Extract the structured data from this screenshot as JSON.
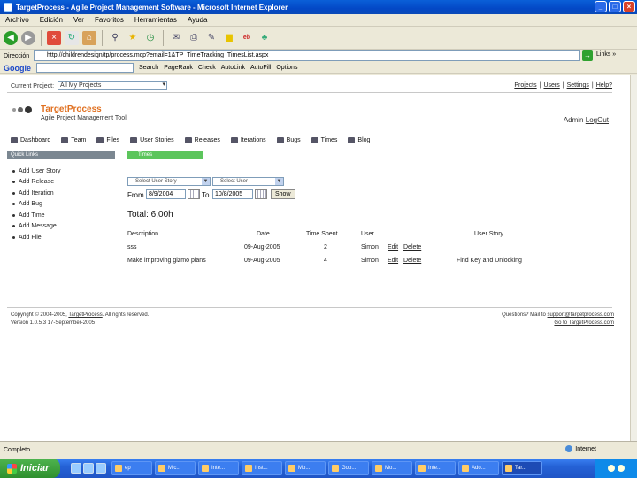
{
  "window": {
    "title": "TargetProcess - Agile Project Management Software - Microsoft Internet Explorer"
  },
  "menu": [
    "Archivo",
    "Edición",
    "Ver",
    "Favoritos",
    "Herramientas",
    "Ayuda"
  ],
  "address": {
    "label": "Dirección",
    "url": "http://childrendesign/tp/process.mcp?email=1&TP_TimeTracking_TimesList.aspx",
    "links": "Links »"
  },
  "google": {
    "logo": "Google",
    "search_label": "Search",
    "items": [
      "PageRank",
      "Check",
      "AutoLink",
      "AutoFill",
      "Options"
    ]
  },
  "page": {
    "current_project_label": "Current Project:",
    "current_project_value": "All My Projects",
    "top_links": [
      "Projects",
      "Users",
      "Settings",
      "Help?"
    ],
    "logo_name": "TargetProcess",
    "logo_tagline": "Agile Project Management Tool",
    "admin_label": "Admin",
    "logout_label": "LogOut",
    "nav": [
      "Dashboard",
      "Team",
      "Files",
      "User Stories",
      "Releases",
      "Iterations",
      "Bugs",
      "Times",
      "Blog"
    ],
    "quick_links_title": "Quick Links",
    "times_tab": "Times",
    "quick_links": [
      "Add User Story",
      "Add Release",
      "Add Iteration",
      "Add Bug",
      "Add Time",
      "Add Message",
      "Add File"
    ],
    "filter": {
      "user_story_placeholder": "Select User Story",
      "user_placeholder": "Select User",
      "from_label": "From",
      "from_value": "8/9/2004",
      "to_label": "To",
      "to_value": "10/8/2005",
      "show_button": "Show"
    },
    "total": "Total: 6,00h",
    "table": {
      "headers": [
        "Description",
        "Date",
        "Time Spent",
        "User",
        "User Story"
      ],
      "rows": [
        [
          "sss",
          "09-Aug-2005",
          "2",
          "Simon",
          "Edit",
          "Delete",
          ""
        ],
        [
          "Make improving gizmo plans",
          "09-Aug-2005",
          "4",
          "Simon",
          "Edit",
          "Delete",
          "Find Key and Unlocking"
        ]
      ]
    },
    "footer": {
      "copyright_prefix": "Copyright © 2004-2005,",
      "company": "TargetProcess",
      "copyright_suffix": ". All rights reserved.",
      "version": "Version 1.0.5.3 17-September-2005",
      "questions_prefix": "Questions? Mail to",
      "email": "support@targetprocess.com",
      "site": "Go to TargetProcess.com"
    }
  },
  "status": {
    "text": "Completo",
    "zone": "Internet"
  },
  "taskbar": {
    "start_label": "Iniciar",
    "tasks": [
      "ep",
      "Mic...",
      "Inte...",
      "Inst...",
      "Mo...",
      "Goo...",
      "Mo...",
      "Inte...",
      "Ado...",
      "Tar..."
    ]
  }
}
